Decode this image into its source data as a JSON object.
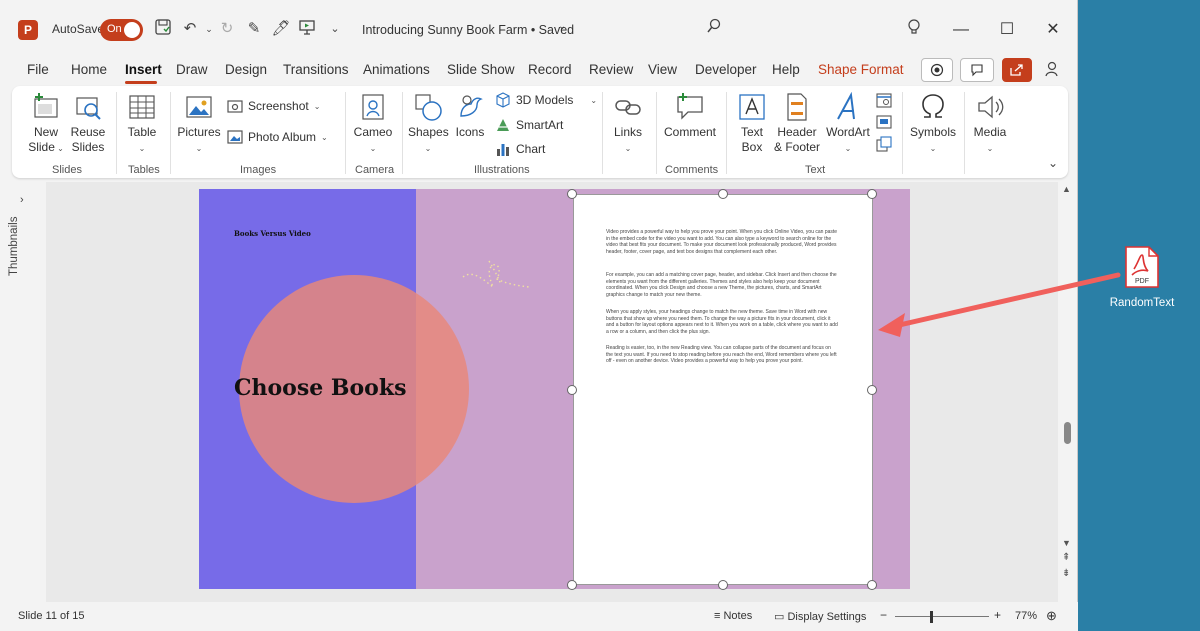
{
  "titlebar": {
    "app_icon_letter": "P",
    "autosave_label": "AutoSave",
    "autosave_state": "On",
    "doc_title": "Introducing Sunny Book Farm • Saved",
    "icons": [
      "save-icon",
      "undo-icon",
      "redo-icon",
      "pen-icon",
      "highlighter-icon",
      "present-icon",
      "customize-icon",
      "search-icon",
      "lightbulb-icon",
      "minimize-icon",
      "maximize-icon",
      "close-icon"
    ]
  },
  "menu": {
    "tabs": [
      "File",
      "Home",
      "Insert",
      "Draw",
      "Design",
      "Transitions",
      "Animations",
      "Slide Show",
      "Record",
      "Review",
      "View",
      "Developer",
      "Help",
      "Shape Format"
    ],
    "active_tab": "Insert",
    "contextual_tab": "Shape Format"
  },
  "ribbon": {
    "groups": [
      {
        "name": "Slides",
        "buttons": [
          "New\nSlide",
          "Reuse\nSlides"
        ]
      },
      {
        "name": "Tables",
        "buttons": [
          "Table"
        ]
      },
      {
        "name": "Images",
        "buttons": [
          "Pictures",
          "Screenshot",
          "Photo Album"
        ]
      },
      {
        "name": "Camera",
        "buttons": [
          "Cameo"
        ]
      },
      {
        "name": "Illustrations",
        "buttons": [
          "Shapes",
          "Icons",
          "3D Models",
          "SmartArt",
          "Chart"
        ]
      },
      {
        "name": "",
        "buttons": [
          "Links"
        ]
      },
      {
        "name": "Comments",
        "buttons": [
          "Comment"
        ]
      },
      {
        "name": "Text",
        "buttons": [
          "Text\nBox",
          "Header\n& Footer",
          "WordArt"
        ]
      },
      {
        "name": "",
        "buttons": [
          "Symbols",
          "Media"
        ]
      }
    ],
    "labels": {
      "new": "New",
      "slide": "Slide",
      "reuse": "Reuse",
      "slides": "Slides",
      "table": "Table",
      "pictures": "Pictures",
      "screenshot": "Screenshot",
      "photo_album": "Photo Album",
      "cameo": "Cameo",
      "shapes": "Shapes",
      "icons": "Icons",
      "models3d": "3D Models",
      "smartart": "SmartArt",
      "chart": "Chart",
      "links": "Links",
      "comment": "Comment",
      "text": "Text",
      "box": "Box",
      "header": "Header",
      "footer": "& Footer",
      "wordart": "WordArt",
      "symbols": "Symbols",
      "media": "Media",
      "g_slides": "Slides",
      "g_tables": "Tables",
      "g_images": "Images",
      "g_camera": "Camera",
      "g_illustrations": "Illustrations",
      "g_comments": "Comments",
      "g_text": "Text"
    }
  },
  "thumbnails_label": "Thumbnails",
  "slide": {
    "small_title": "Books Versus Video",
    "big_title": "Choose Books",
    "colors": {
      "left_panel": "#776be8",
      "right_panel": "#c9a2cc",
      "circle": "#e8887a"
    },
    "paragraphs": [
      "Video provides a powerful way to help you prove your point. When you click Online Video, you can paste in the embed code for the video you want to add. You can also type a keyword to search online for the video that best fits your document. To make your document look professionally produced, Word provides header, footer, cover page, and text box designs that complement each other.",
      "For example, you can add a matching cover page, header, and sidebar. Click Insert and then choose the elements you want from the different galleries. Themes and styles also help keep your document coordinated. When you click Design and choose a new Theme, the pictures, charts, and SmartArt graphics change to match your new theme.",
      "When you apply styles, your headings change to match the new theme. Save time in Word with new buttons that show up where you need them. To change the way a picture fits in your document, click it and a button for layout options appears next to it. When you work on a table, click where you want to add a row or a column, and then click the plus sign.",
      "Reading is easier, too, in the new Reading view. You can collapse parts of the document and focus on the text you want. If you need to stop reading before you reach the end, Word remembers where you left off - even on another device. Video provides a powerful way to help you prove your point."
    ]
  },
  "status": {
    "slide_info": "Slide 11 of 15",
    "notes": "Notes",
    "display_settings": "Display Settings",
    "zoom_minus": "−",
    "zoom_plus": "+",
    "zoom": "77%",
    "zoom_level_percent": 77
  },
  "desktop": {
    "file_badge": "PDF",
    "file_name": "RandomText",
    "arrow_color": "#f0605c"
  }
}
